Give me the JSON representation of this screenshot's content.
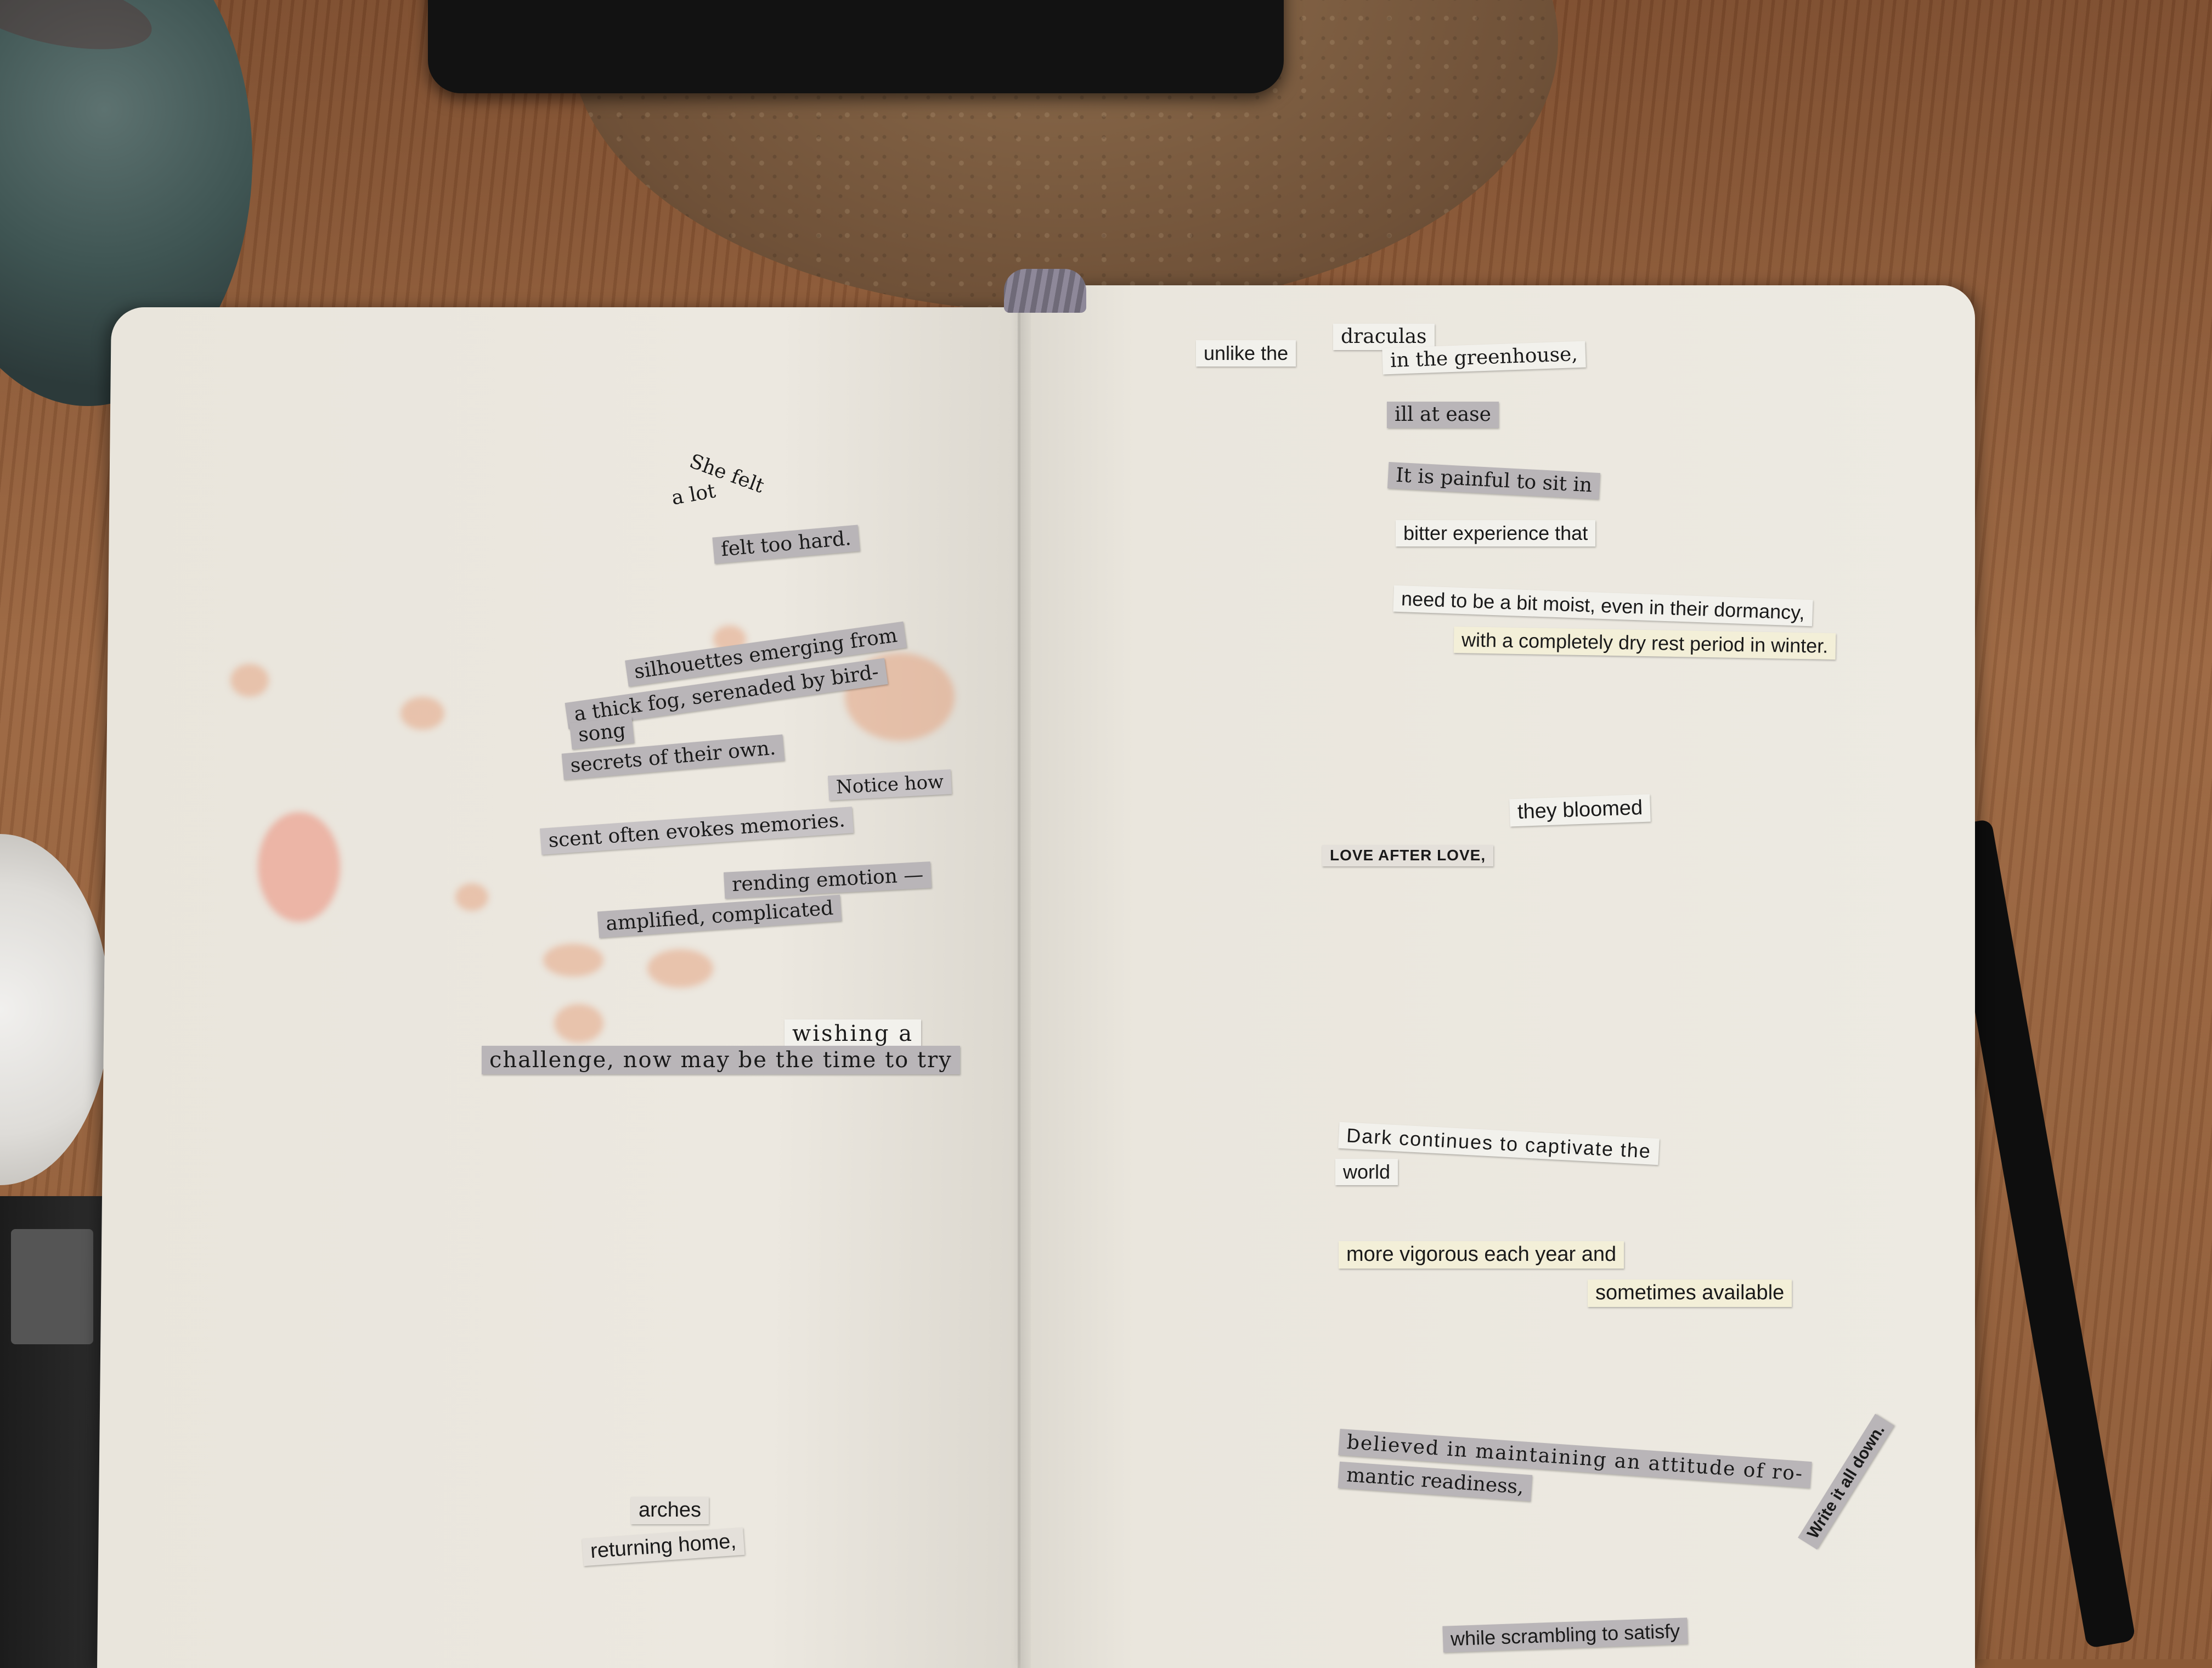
{
  "left_page": {
    "snippets": [
      "She felt",
      "a lot",
      "felt too hard.",
      "silhouettes emerging from",
      "a thick fog, serenaded by bird-",
      "song",
      "secrets of their own.",
      "Notice how",
      "scent often evokes memories.",
      "rending emotion —",
      "amplified, complicated",
      "wishing a",
      "challenge, now may be the time to try",
      "arches",
      "returning home,"
    ]
  },
  "right_page": {
    "snippets": [
      "unlike the",
      "draculas",
      "in the greenhouse,",
      "ill at ease",
      "It is painful to sit in",
      "bitter experience that",
      "need to be a bit moist, even in their dormancy,",
      "with a completely dry rest period in winter.",
      "they bloomed",
      "LOVE AFTER LOVE,",
      "Dark continues to captivate the",
      "world",
      "more vigorous each year and",
      "sometimes available",
      "believed in maintaining an attitude of ro-",
      "mantic readiness,",
      "Write it all down.",
      "while scrambling to satisfy"
    ]
  },
  "colors": {
    "table_wood": "#8a5a36",
    "page_paper": "#ece8e0",
    "snippet_grey": "#b9b5b8",
    "snippet_cream": "#f3efd8",
    "stain": "#e4966e"
  }
}
